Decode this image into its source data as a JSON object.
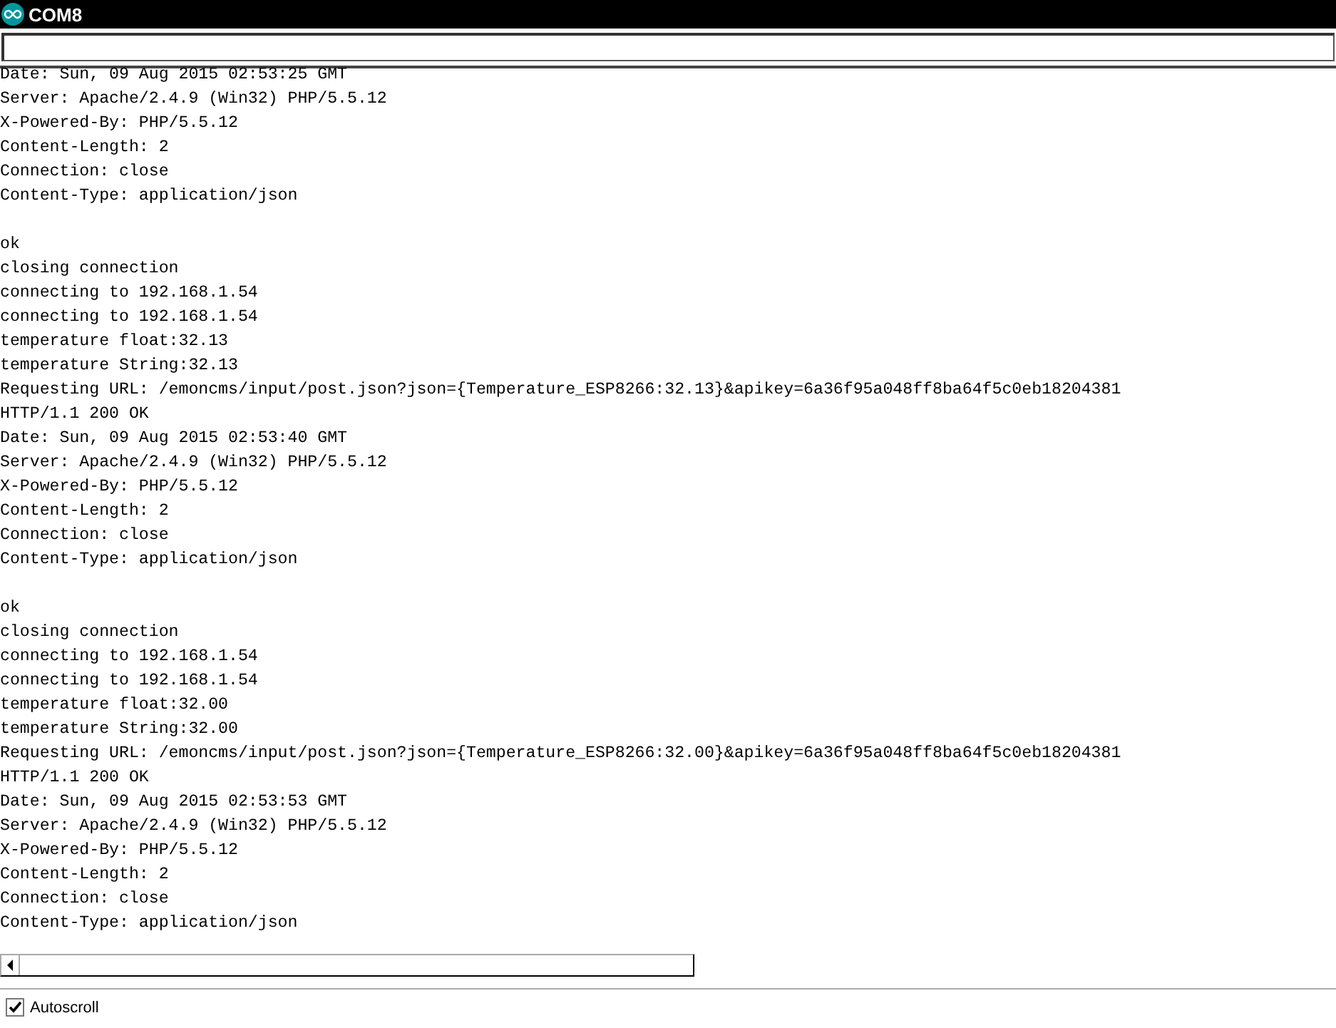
{
  "window": {
    "title": "COM8"
  },
  "output": [
    [
      "Date: Sun, 09 Aug 2015 02:53:25 GMT",
      "Server: Apache/2.4.9 (Win32) PHP/5.5.12",
      "X-Powered-By: PHP/5.5.12",
      "Content-Length: 2",
      "Connection: close",
      "Content-Type: application/json"
    ],
    [
      "ok",
      "closing connection",
      "connecting to 192.168.1.54",
      "connecting to 192.168.1.54",
      "temperature float:32.13",
      "temperature String:32.13",
      "Requesting URL: /emoncms/input/post.json?json={Temperature_ESP8266:32.13}&apikey=6a36f95a048ff8ba64f5c0eb18204381",
      "HTTP/1.1 200 OK",
      "Date: Sun, 09 Aug 2015 02:53:40 GMT",
      "Server: Apache/2.4.9 (Win32) PHP/5.5.12",
      "X-Powered-By: PHP/5.5.12",
      "Content-Length: 2",
      "Connection: close",
      "Content-Type: application/json"
    ],
    [
      "ok",
      "closing connection",
      "connecting to 192.168.1.54",
      "connecting to 192.168.1.54",
      "temperature float:32.00",
      "temperature String:32.00",
      "Requesting URL: /emoncms/input/post.json?json={Temperature_ESP8266:32.00}&apikey=6a36f95a048ff8ba64f5c0eb18204381",
      "HTTP/1.1 200 OK",
      "Date: Sun, 09 Aug 2015 02:53:53 GMT",
      "Server: Apache/2.4.9 (Win32) PHP/5.5.12",
      "X-Powered-By: PHP/5.5.12",
      "Content-Length: 2",
      "Connection: close",
      "Content-Type: application/json"
    ]
  ],
  "autoscroll": {
    "label": "Autoscroll",
    "checked": true
  }
}
